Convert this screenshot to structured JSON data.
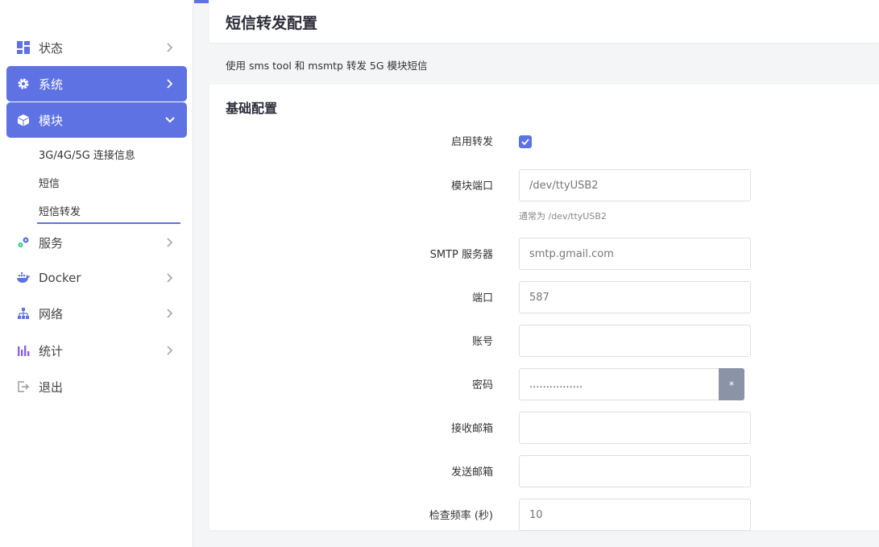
{
  "sidebar": {
    "items": [
      {
        "label": "状态",
        "icon": "dashboard-icon",
        "active": false
      },
      {
        "label": "系统",
        "icon": "gear-icon",
        "active": true
      },
      {
        "label": "模块",
        "icon": "cube-icon",
        "active": true,
        "expanded": true
      },
      {
        "label": "服务",
        "icon": "services-icon",
        "active": false
      },
      {
        "label": "Docker",
        "icon": "docker-icon",
        "active": false
      },
      {
        "label": "网络",
        "icon": "network-icon",
        "active": false
      },
      {
        "label": "统计",
        "icon": "stats-icon",
        "active": false
      },
      {
        "label": "退出",
        "icon": "logout-icon",
        "active": false
      }
    ],
    "subitems": [
      {
        "label": "3G/4G/5G 连接信息"
      },
      {
        "label": "短信"
      },
      {
        "label": "短信转发",
        "selected": true
      }
    ]
  },
  "header": {
    "title": "短信转发配置"
  },
  "description": "使用 sms  tool 和 msmtp 转发 5G 模块短信",
  "section": {
    "title": "基础配置",
    "fields": {
      "enable": {
        "label": "启用转发",
        "checked": true
      },
      "port_device": {
        "label": "模块端口",
        "placeholder": "/dev/ttyUSB2",
        "hint": "通常为 /dev/ttyUSB2"
      },
      "smtp_server": {
        "label": "SMTP 服务器",
        "placeholder": "smtp.gmail.com"
      },
      "smtp_port": {
        "label": "端口",
        "placeholder": "587"
      },
      "account": {
        "label": "账号",
        "value": ""
      },
      "password": {
        "label": "密码",
        "value": "................",
        "reveal_label": "*"
      },
      "recv_mail": {
        "label": "接收邮箱",
        "value": ""
      },
      "send_mail": {
        "label": "发送邮箱",
        "value": ""
      },
      "interval": {
        "label": "检查频率 (秒)",
        "placeholder": "10"
      }
    }
  },
  "colors": {
    "accent": "#5e72e4",
    "reveal_button": "#8a94a6"
  }
}
